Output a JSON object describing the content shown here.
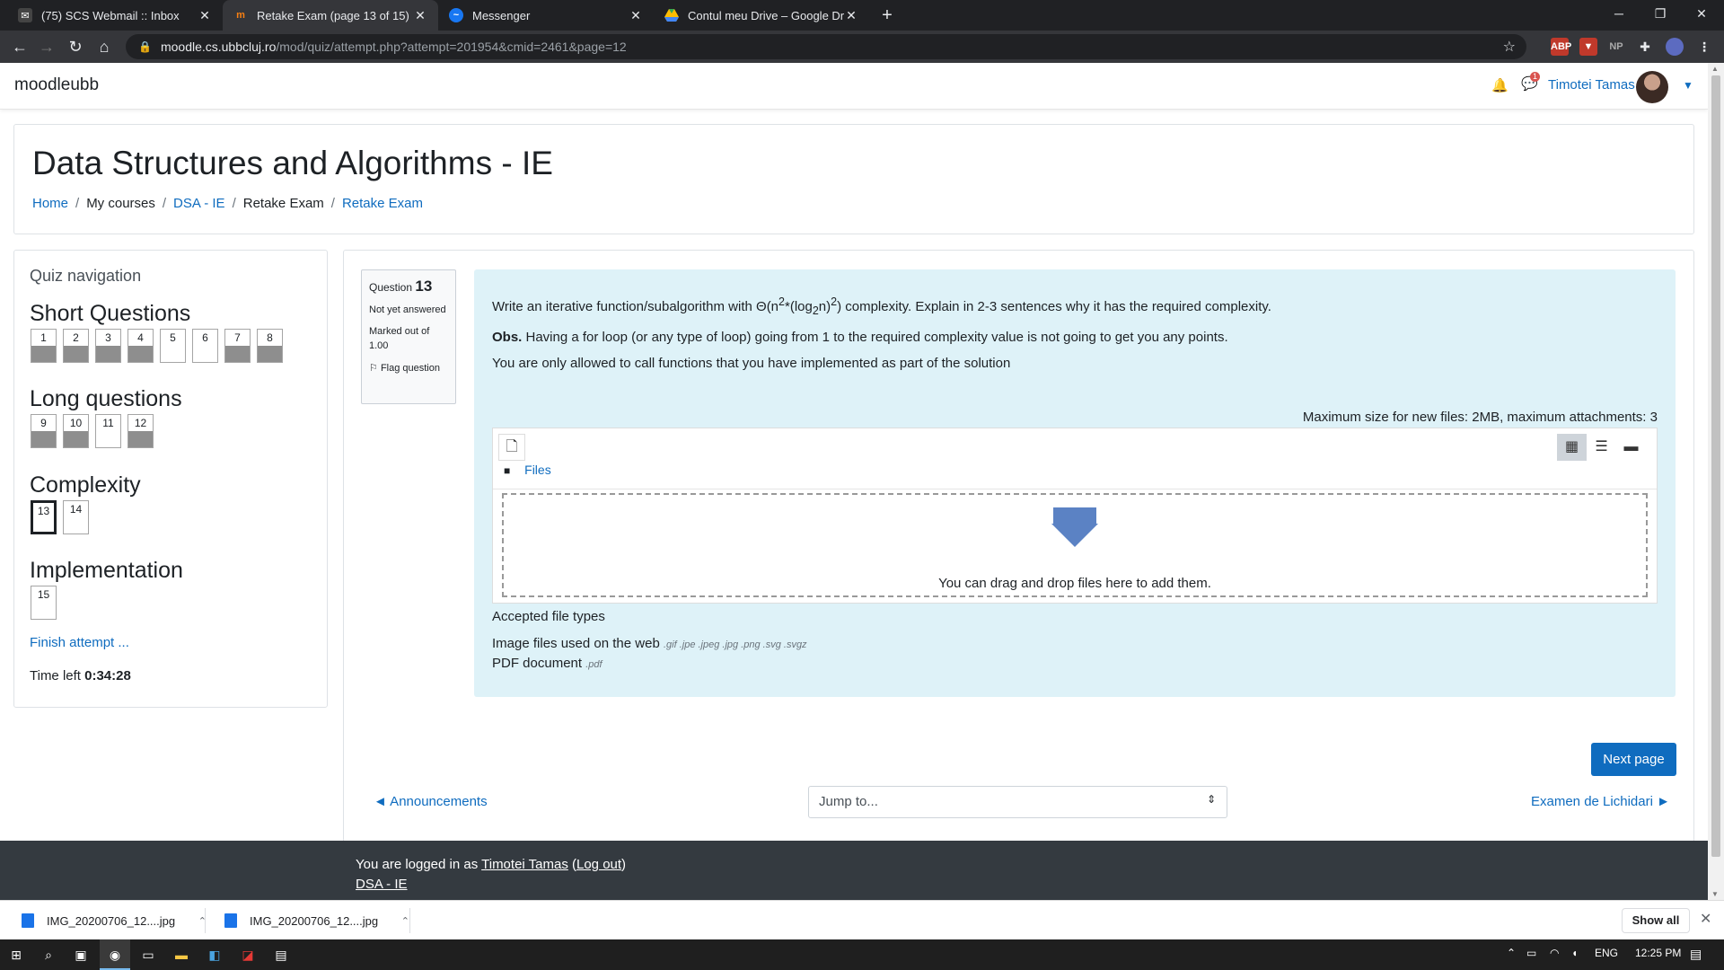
{
  "browser": {
    "tabs": [
      {
        "title": "(75) SCS Webmail :: Inbox",
        "favicon": "mail-icon",
        "active": false
      },
      {
        "title": "Retake Exam (page 13 of 15)",
        "favicon": "moodle-icon",
        "active": true
      },
      {
        "title": "Messenger",
        "favicon": "messenger-icon",
        "active": false
      },
      {
        "title": "Contul meu Drive – Google Drive",
        "favicon": "drive-icon",
        "active": false
      }
    ],
    "url_host": "moodle.cs.ubbcluj.ro",
    "url_path": "/mod/quiz/attempt.php?attempt=201954&cmid=2461&page=12",
    "extensions": [
      "ABP",
      "NP"
    ]
  },
  "navbar": {
    "brand": "moodleubb",
    "message_badge": "1",
    "username": "Timotei Tamas"
  },
  "header": {
    "course_title": "Data Structures and Algorithms - IE",
    "breadcrumb": [
      "Home",
      "My courses",
      "DSA - IE",
      "Retake Exam",
      "Retake Exam"
    ]
  },
  "quiz_nav": {
    "title": "Quiz navigation",
    "sections": [
      {
        "heading": "Short Questions",
        "questions": [
          {
            "n": "1",
            "answered": true
          },
          {
            "n": "2",
            "answered": true
          },
          {
            "n": "3",
            "answered": true
          },
          {
            "n": "4",
            "answered": true
          },
          {
            "n": "5",
            "answered": false
          },
          {
            "n": "6",
            "answered": false
          },
          {
            "n": "7",
            "answered": true
          },
          {
            "n": "8",
            "answered": true
          }
        ]
      },
      {
        "heading": "Long questions",
        "questions": [
          {
            "n": "9",
            "answered": true
          },
          {
            "n": "10",
            "answered": true
          },
          {
            "n": "11",
            "answered": false
          },
          {
            "n": "12",
            "answered": true
          }
        ]
      },
      {
        "heading": "Complexity",
        "questions": [
          {
            "n": "13",
            "answered": false,
            "current": true
          },
          {
            "n": "14",
            "answered": false
          }
        ]
      },
      {
        "heading": "Implementation",
        "questions": [
          {
            "n": "15",
            "answered": false
          }
        ]
      }
    ],
    "finish_label": "Finish attempt ...",
    "time_left_label": "Time left",
    "time_left_value": "0:34:28"
  },
  "question": {
    "label": "Question",
    "number": "13",
    "status": "Not yet answered",
    "marked": "Marked out of 1.00",
    "flag_label": "Flag question",
    "text_line1_prefix": "Write an iterative function/subalgorithm with Θ(n",
    "text_line1_sup1": "2",
    "text_line1_mid": "*(log",
    "text_line1_sub": "2",
    "text_line1_mid2": "n)",
    "text_line1_sup2": "2",
    "text_line1_suffix": ") complexity. Explain in 2-3 sentences why it has the required complexity.",
    "obs_label": "Obs.",
    "obs_text": " Having a for loop (or any type of loop) going from 1 to the required complexity value is not going to get you any points.",
    "line3": "You are only allowed to call functions that you have implemented as part of the solution",
    "max_size": "Maximum size for new files: 2MB, maximum attachments: 3",
    "files_label": "Files",
    "drop_text": "You can drag and drop files here to add them.",
    "accepted_title": "Accepted file types",
    "accepted": [
      {
        "name": "Image files used on the web",
        "ext": ".gif .jpe .jpeg .jpg .png .svg .svgz"
      },
      {
        "name": "PDF document",
        "ext": ".pdf"
      }
    ]
  },
  "navigation": {
    "next_page": "Next page",
    "prev_activity": "◄ Announcements",
    "jump_to": "Jump to...",
    "next_activity": "Examen de Lichidari ►"
  },
  "footer": {
    "logged_prefix": "You are logged in as ",
    "user": "Timotei Tamas",
    "logout": "Log out",
    "course": "DSA - IE"
  },
  "downloads": [
    {
      "name": "IMG_20200706_12....jpg"
    },
    {
      "name": "IMG_20200706_12....jpg"
    }
  ],
  "show_all": "Show all",
  "taskbar": {
    "lang": "ENG",
    "time": "12:25 PM"
  },
  "colors": {
    "accent": "#0f6cbf",
    "question_bg": "#def2f8",
    "footer_bg": "#343a40"
  }
}
